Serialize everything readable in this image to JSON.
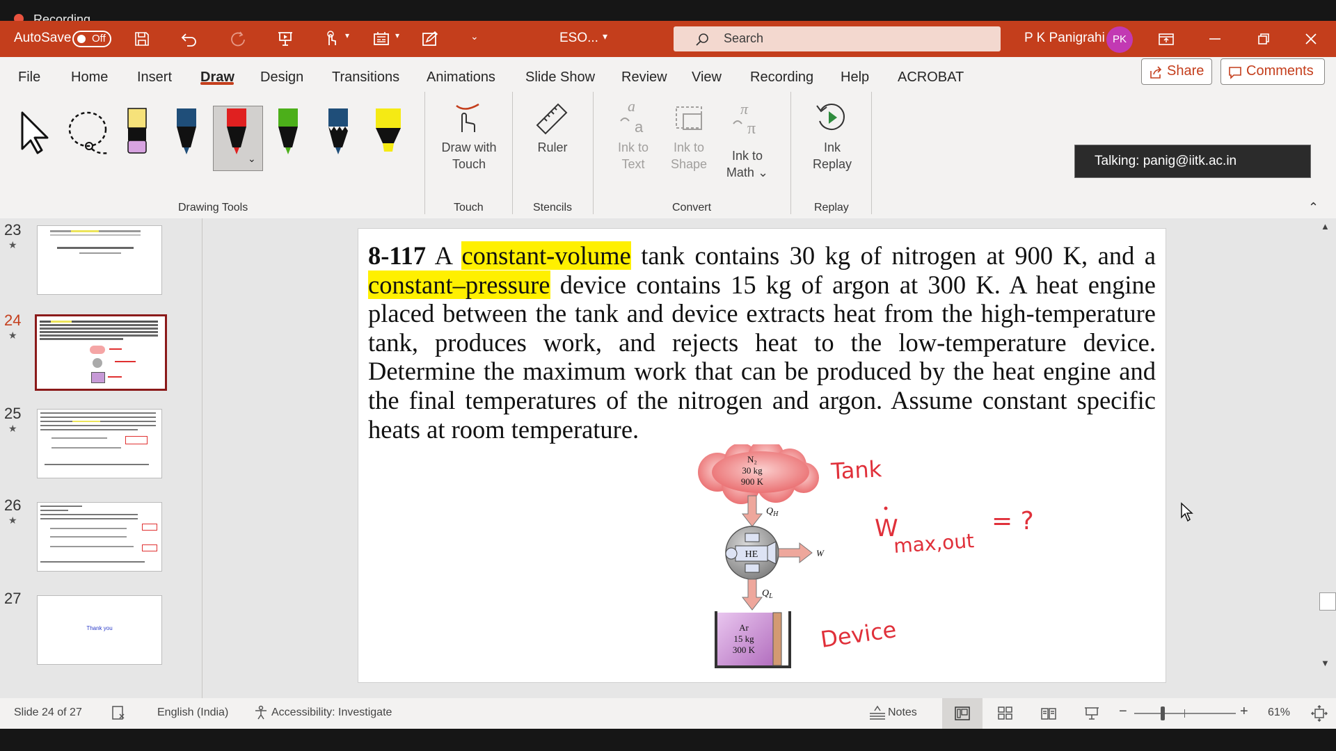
{
  "recording": {
    "label": "Recording"
  },
  "titlebar": {
    "autosave_label": "AutoSave",
    "autosave_state": "Off",
    "filename": "ESO...",
    "search_placeholder": "Search",
    "user_name": "P K Panigrahi",
    "user_initials": "PK"
  },
  "ribbon": {
    "tabs": [
      "File",
      "Home",
      "Insert",
      "Draw",
      "Design",
      "Transitions",
      "Animations",
      "Slide Show",
      "Review",
      "View",
      "Recording",
      "Help",
      "ACROBAT"
    ],
    "active_tab": "Draw",
    "share_label": "Share",
    "comments_label": "Comments",
    "groups": {
      "drawing_tools": "Drawing Tools",
      "touch": "Touch",
      "stencils": "Stencils",
      "convert": "Convert",
      "replay": "Replay"
    },
    "commands": {
      "draw_with_touch": [
        "Draw with",
        "Touch"
      ],
      "ruler": "Ruler",
      "ink_to_text": [
        "Ink to",
        "Text"
      ],
      "ink_to_shape": [
        "Ink to",
        "Shape"
      ],
      "ink_to_math": [
        "Ink to",
        "Math"
      ],
      "ink_replay": [
        "Ink",
        "Replay"
      ]
    },
    "pen_colors": [
      "#f6e27a",
      "#1f4e79",
      "#e02020",
      "#4caf1a",
      "#1f4e79",
      "#f5ea14"
    ],
    "talking": "Talking: panig@iitk.ac.in"
  },
  "thumbnails": [
    {
      "num": "23",
      "selected": false
    },
    {
      "num": "24",
      "selected": true
    },
    {
      "num": "25",
      "selected": false
    },
    {
      "num": "26",
      "selected": false
    },
    {
      "num": "27",
      "selected": false,
      "text": "Thank you"
    }
  ],
  "slide": {
    "problem_number": "8-117",
    "text_before_hl1": " A ",
    "highlight_1": "constant-volume",
    "text_mid_1": " tank contains 30 kg of nitrogen at 900 K, and a ",
    "highlight_2": "constant–pressure",
    "text_rest": " device contains 15 kg of argon at 300 K. A heat engine placed between the tank and device extracts heat from the high-temperature tank, produces work, and rejects heat to the low-temperature device. Determine the maximum work that can be produced by the heat engine and the final temperatures of the nitrogen and argon. Assume constant specific heats at room temperature.",
    "diagram": {
      "cloud_l1": "N₂",
      "cloud_l2": "30 kg",
      "cloud_l3": "900 K",
      "qh": "Q",
      "qh_sub": "H",
      "he": "HE",
      "w": "W",
      "ql": "Q",
      "ql_sub": "L",
      "box_l1": "Ar",
      "box_l2": "15 kg",
      "box_l3": "300 K"
    },
    "handwriting": {
      "tank": "Tank",
      "w_dot": "W",
      "w_sub": "max,out",
      "eq": "= ?",
      "device": "Device"
    }
  },
  "statusbar": {
    "slide_info": "Slide 24 of 27",
    "language": "English (India)",
    "accessibility": "Accessibility: Investigate",
    "notes": "Notes",
    "zoom": "61%"
  },
  "colors": {
    "accent": "#c43e1c",
    "highlight": "#fff000",
    "ink": "#e0303a"
  }
}
